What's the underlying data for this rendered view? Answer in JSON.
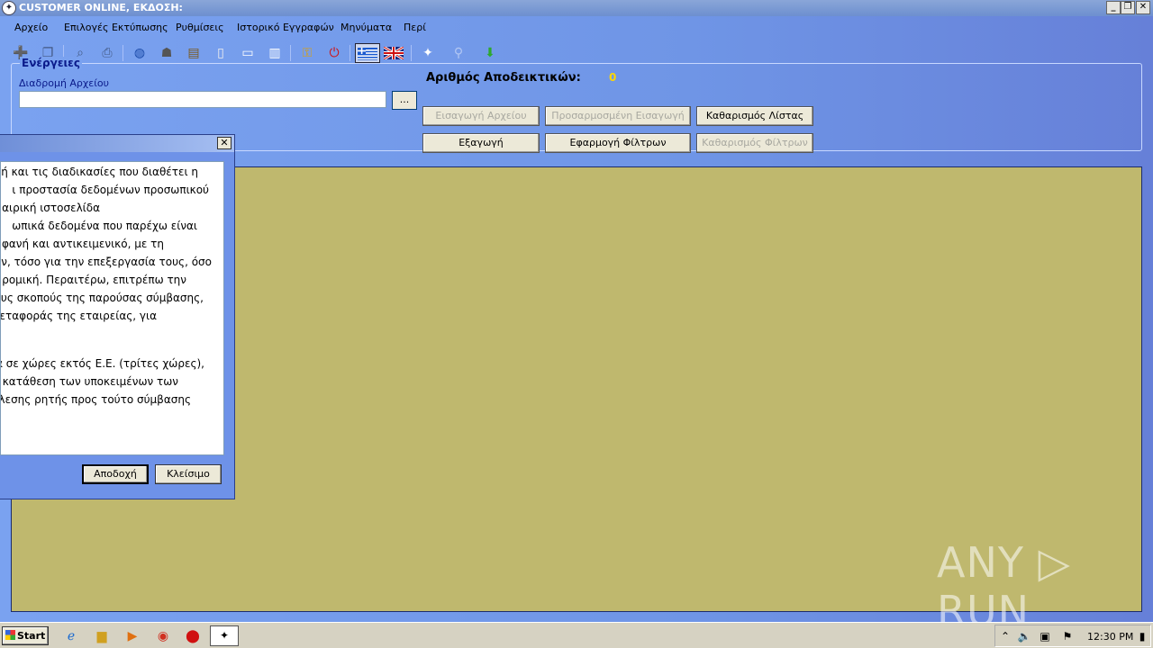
{
  "window": {
    "title": "CUSTOMER ONLINE, ΕΚΔΟΣΗ:",
    "minimize": "_",
    "restore": "❐",
    "close": "✕"
  },
  "menu": [
    "Αρχείο",
    "Επιλογές Εκτύπωσης",
    "Ρυθμίσεις",
    "Ιστορικό Εγγραφών",
    "Μηνύματα",
    "Περί"
  ],
  "toolbar_icons": [
    "new-file-icon",
    "copy-icon",
    "zoom-icon",
    "print-icon",
    "web-globe-icon",
    "users-icon",
    "clipboard-icon",
    "document-icon",
    "window-icon",
    "book-icon",
    "key-icon",
    "power-icon",
    "greek-flag-icon",
    "uk-flag-icon",
    "app-logo-icon",
    "search-icon",
    "download-icon"
  ],
  "actions": {
    "group_title": "Ενέργειες",
    "path_label": "Διαδρομή Αρχείου",
    "path_value": "",
    "browse_label": "...",
    "receipts_label": "Αριθμός Αποδεικτικών:",
    "receipts_count": "0",
    "import_file": "Εισαγωγή Αρχείου",
    "custom_import": "Προσαρμοσμένη Εισαγωγή",
    "clear_list": "Καθαρισμός Λίστας",
    "export": "Εξαγωγή",
    "apply_filters": "Εφαρμογή Φίλτρων",
    "clear_filters": "Καθαρισμός Φίλτρων"
  },
  "dialog": {
    "close": "✕",
    "lines": [
      "ή και τις διαδικασίες που διαθέτει η",
      "ι προστασία δεδομένων προσωπικού",
      "αιρική ιστοσελίδα",
      "ωπικά δεδομένα που παρέχω είναι",
      "φανή και αντικειμενικό, με τη",
      "ν, τόσο για την επεξεργασία τους, όσο",
      "ρομική. Περαιτέρω, επιτρέπω την",
      "υς σκοπούς της παρούσας σύμβασης,",
      "εταφοράς της εταιρείας, για",
      "",
      "",
      "να σε χώρες εκτός Ε.Ε. (τρίτες χώρες),",
      "κατάθεση των υποκειμένων των",
      "λεσης ρητής προς τούτο σύμβασης"
    ],
    "accept": "Αποδοχή",
    "close_btn": "Κλείσιμο"
  },
  "watermark": "ANY ▷ RUN",
  "taskbar": {
    "start": "Start",
    "clock": "12:30 PM"
  }
}
